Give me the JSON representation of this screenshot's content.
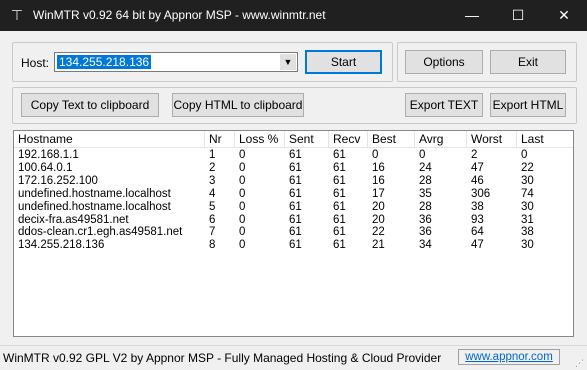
{
  "window": {
    "title": "WinMTR v0.92 64 bit by Appnor MSP - www.winmtr.net",
    "icon": "tool-icon",
    "controls": {
      "minimize": "—",
      "maximize": "☐",
      "close": "✕"
    }
  },
  "host": {
    "label": "Host:",
    "value": "134.255.218.136"
  },
  "buttons": {
    "start": "Start",
    "options": "Options",
    "exit": "Exit",
    "copy_text": "Copy Text to clipboard",
    "copy_html": "Copy HTML to clipboard",
    "export_text": "Export TEXT",
    "export_html": "Export HTML"
  },
  "table": {
    "columns": [
      "Hostname",
      "Nr",
      "Loss %",
      "Sent",
      "Recv",
      "Best",
      "Avrg",
      "Worst",
      "Last"
    ],
    "rows": [
      [
        "192.168.1.1",
        "1",
        "0",
        "61",
        "61",
        "0",
        "0",
        "2",
        "0"
      ],
      [
        "100.64.0.1",
        "2",
        "0",
        "61",
        "61",
        "16",
        "24",
        "47",
        "22"
      ],
      [
        "172.16.252.100",
        "3",
        "0",
        "61",
        "61",
        "16",
        "28",
        "46",
        "30"
      ],
      [
        "undefined.hostname.localhost",
        "4",
        "0",
        "61",
        "61",
        "17",
        "35",
        "306",
        "74"
      ],
      [
        "undefined.hostname.localhost",
        "5",
        "0",
        "61",
        "61",
        "20",
        "28",
        "38",
        "30"
      ],
      [
        "decix-fra.as49581.net",
        "6",
        "0",
        "61",
        "61",
        "20",
        "36",
        "93",
        "31"
      ],
      [
        "ddos-clean.cr1.egh.as49581.net",
        "7",
        "0",
        "61",
        "61",
        "22",
        "36",
        "64",
        "38"
      ],
      [
        "134.255.218.136",
        "8",
        "0",
        "61",
        "61",
        "21",
        "34",
        "47",
        "30"
      ]
    ]
  },
  "status": {
    "text": "WinMTR v0.92 GPL V2 by Appnor MSP - Fully Managed Hosting & Cloud Provider",
    "link": "www.appnor.com"
  },
  "colors": {
    "titlebar": "#202020",
    "selection": "#0078d7",
    "link": "#0066cc"
  }
}
